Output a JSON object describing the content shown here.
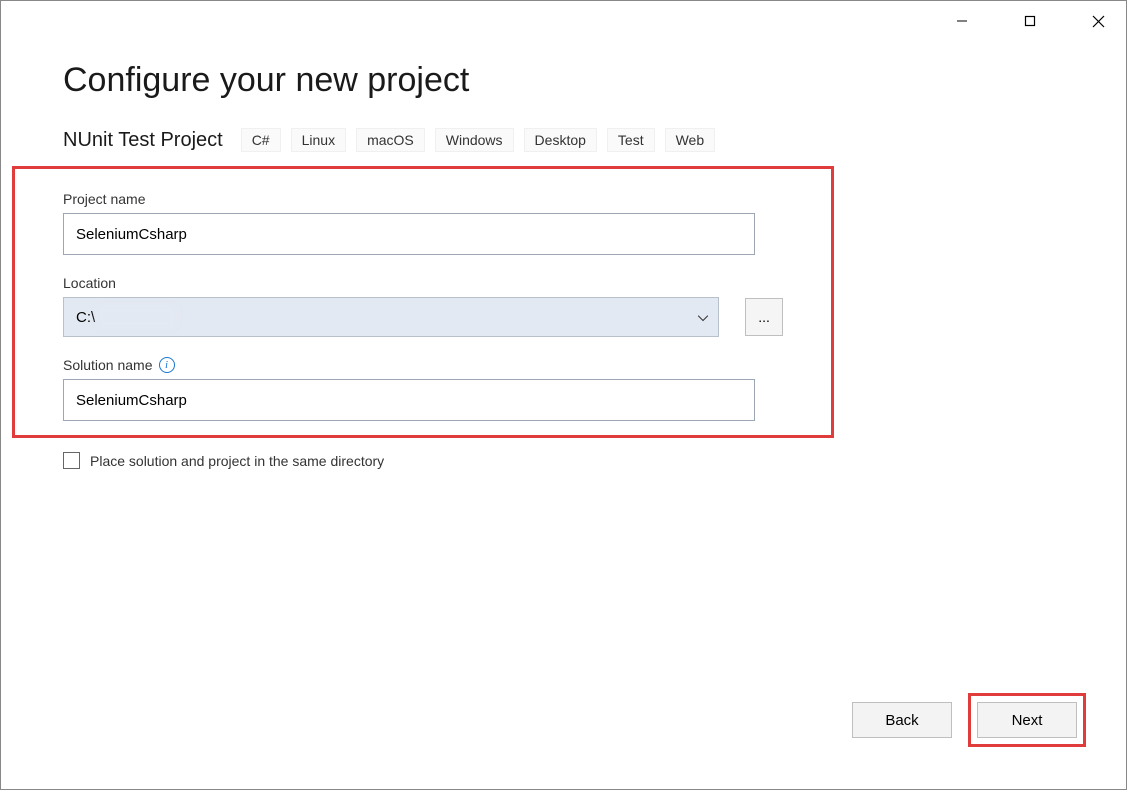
{
  "windowControls": {
    "minimize": "minimize",
    "maximize": "maximize",
    "close": "close"
  },
  "title": "Configure your new project",
  "templateName": "NUnit Test Project",
  "tags": [
    "C#",
    "Linux",
    "macOS",
    "Windows",
    "Desktop",
    "Test",
    "Web"
  ],
  "fields": {
    "projectName": {
      "label": "Project name",
      "value": "SeleniumCsharp"
    },
    "location": {
      "label": "Location",
      "value": "C:\\",
      "browseLabel": "..."
    },
    "solutionName": {
      "label": "Solution name",
      "value": "SeleniumCsharp"
    }
  },
  "checkbox": {
    "label": "Place solution and project in the same directory",
    "checked": false
  },
  "footer": {
    "backLabel": "Back",
    "nextLabel": "Next"
  }
}
